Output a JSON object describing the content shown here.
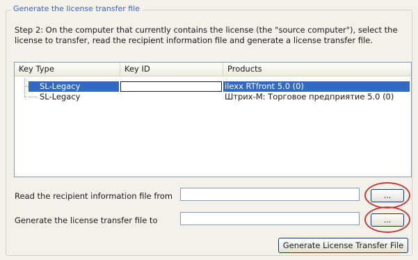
{
  "group": {
    "title": "Generate the license transfer file"
  },
  "step_text": "Step 2: On the computer that currently contains the license (the \"source computer\"), select the license to transfer, read the recipient information file and generate a license transfer file.",
  "license_list": {
    "columns": [
      "Key Type",
      "Key ID",
      "Products"
    ],
    "rows": [
      {
        "key_type": "SL-Legacy",
        "key_id": "",
        "products": "ilexx RTfront 5.0 (0)",
        "selected": true
      },
      {
        "key_type": "SL-Legacy",
        "key_id": "",
        "products": "Штрих-М: Торговое предприятие 5.0 (0)",
        "selected": false
      }
    ]
  },
  "recipient_file": {
    "label": "Read the recipient information file from",
    "value": "",
    "browse_label": "..."
  },
  "transfer_file": {
    "label": "Generate the license transfer file to",
    "value": "",
    "browse_label": "..."
  },
  "generate_button": "Generate License Transfer File",
  "colors": {
    "title_blue": "#3b63c4",
    "selection": "#316ac5",
    "highlight_red": "#c23a3a"
  }
}
